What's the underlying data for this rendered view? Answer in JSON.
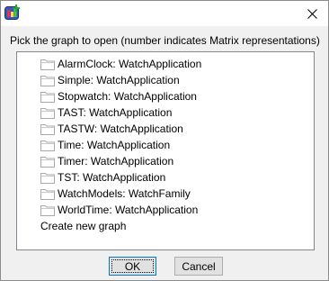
{
  "dialog": {
    "prompt": "Pick the graph to open (number indicates Matrix representations)",
    "icons": {
      "app": "app-icon",
      "close": "close-icon",
      "item": "folder-icon"
    }
  },
  "graphs": [
    {
      "label": "AlarmClock: WatchApplication"
    },
    {
      "label": "Simple: WatchApplication"
    },
    {
      "label": "Stopwatch: WatchApplication"
    },
    {
      "label": "TAST: WatchApplication"
    },
    {
      "label": "TASTW: WatchApplication"
    },
    {
      "label": "Time: WatchApplication"
    },
    {
      "label": "Timer: WatchApplication"
    },
    {
      "label": "TST: WatchApplication"
    },
    {
      "label": "WatchModels: WatchFamily"
    },
    {
      "label": "WorldTime: WatchApplication"
    }
  ],
  "create_new": "Create new graph",
  "buttons": {
    "ok": "OK",
    "cancel": "Cancel"
  },
  "colors": {
    "accent": "#0078d7",
    "list_border": "#828790",
    "background": "#f0f0f0"
  }
}
